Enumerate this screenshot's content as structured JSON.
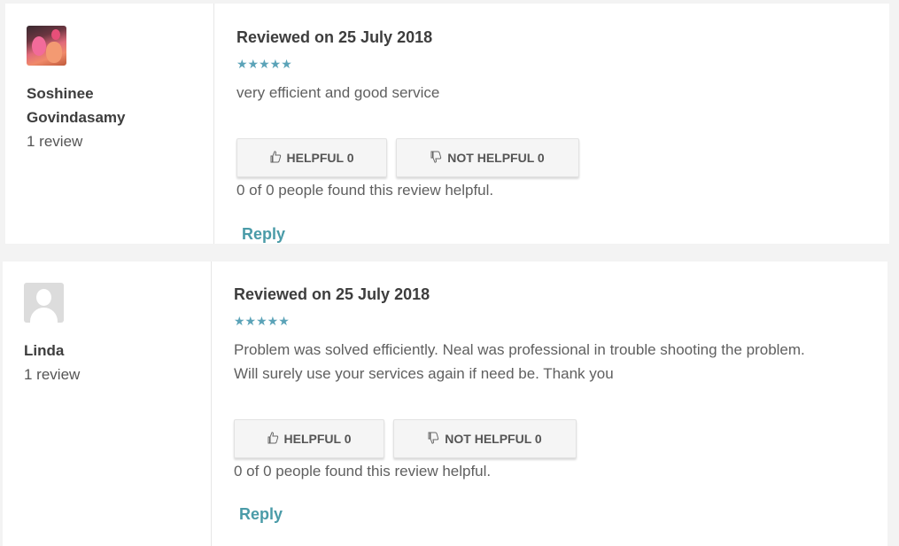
{
  "colors": {
    "star": "#5ba3b8",
    "reply_link": "#4a9ba8",
    "text": "#5f5f5f",
    "heading": "#3d3d3d"
  },
  "reviews": [
    {
      "author_name": "Soshinee Govindasamy",
      "review_count": "1 review",
      "avatar_icon": "user-photo",
      "date_label": "Reviewed on 25 July 2018",
      "rating": 5,
      "stars": "★★★★★",
      "text": "very efficient and good service",
      "helpful_label": "HELPFUL 0",
      "not_helpful_label": "NOT HELPFUL 0",
      "helpful_summary": "0 of 0 people found this review helpful.",
      "reply_label": "Reply"
    },
    {
      "author_name": "Linda",
      "review_count": "1 review",
      "avatar_icon": "default-avatar-icon",
      "date_label": "Reviewed on 25 July 2018",
      "rating": 5,
      "stars": "★★★★★",
      "text": "Problem was solved efficiently. Neal was professional in trouble shooting the problem. Will surely use your services again if need be. Thank you",
      "helpful_label": "HELPFUL 0",
      "not_helpful_label": "NOT HELPFUL 0",
      "helpful_summary": "0 of 0 people found this review helpful.",
      "reply_label": "Reply"
    }
  ],
  "icons": {
    "thumbs_up": "👍",
    "thumbs_down": "👎"
  }
}
